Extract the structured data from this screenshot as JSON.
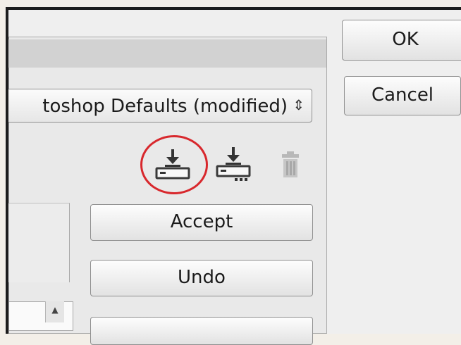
{
  "dialog": {
    "preset": {
      "value": "toshop Defaults (modified)",
      "arrows_icon": "up-down-arrows-icon"
    },
    "preset_icons": {
      "save": "save-preset-icon",
      "save_as": "save-preset-as-icon",
      "delete": "trash-icon",
      "highlight_color": "#d8282d"
    },
    "buttons": {
      "accept": "Accept",
      "undo": "Undo",
      "ok": "OK",
      "cancel": "Cancel"
    }
  }
}
